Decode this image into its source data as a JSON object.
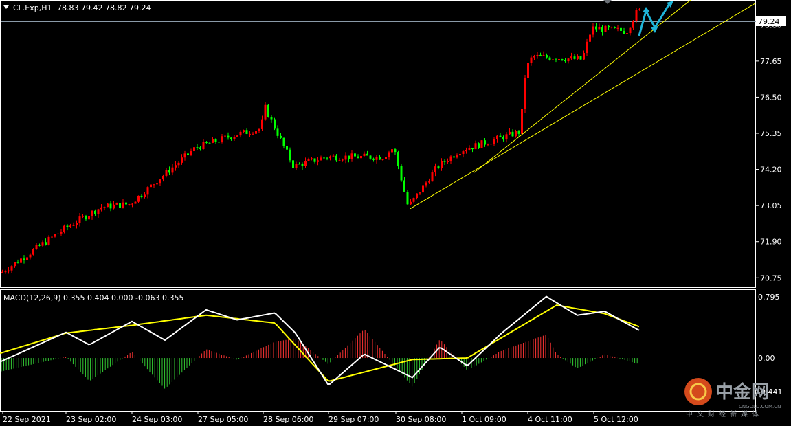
{
  "header": {
    "symbol": "CL.Exp,H1",
    "ohlc": "78.83 79.42 78.82 79.24"
  },
  "price_axis": {
    "current_price": "79.24",
    "ticks": [
      "78.80",
      "77.65",
      "76.50",
      "75.35",
      "74.20",
      "73.05",
      "71.90",
      "70.75"
    ]
  },
  "macd": {
    "label": "MACD(12,26,9) 0.355 0.404 0.000 -0.063 0.355",
    "ticks": [
      "0.795",
      "0.00",
      "-0.441"
    ]
  },
  "time_axis": {
    "ticks": [
      "22 Sep 2021",
      "23 Sep 02:00",
      "24 Sep 03:00",
      "27 Sep 05:00",
      "28 Sep 06:00",
      "29 Sep 07:00",
      "30 Sep 08:00",
      "1 Oct 09:00",
      "4 Oct 11:00",
      "5 Oct 12:00"
    ]
  },
  "watermark": {
    "brand": "中金网",
    "domain": "CNGOLD.COM.CN",
    "tagline": "中文财经新媒体"
  },
  "colors": {
    "background": "#000000",
    "bull": "#ff0000",
    "bear": "#00ff00",
    "grid_text": "#ffffff",
    "trendline": "#ffff00",
    "arrow": "#1fb5d8",
    "macd_line": "#ffffff",
    "signal_line": "#ffff00",
    "hist_pos": "#ff3333",
    "hist_neg": "#33cc33"
  },
  "chart_data": [
    {
      "type": "candlestick",
      "symbol": "CL.Exp",
      "timeframe": "H1",
      "ylim": [
        70.45,
        79.55
      ],
      "current_price": 79.24,
      "anchors": [
        {
          "x": "22 Sep 2021",
          "price": 70.9
        },
        {
          "x": "23 Sep 02:00",
          "price": 72.3
        },
        {
          "x": "23 Sep mid",
          "price": 73.0
        },
        {
          "x": "24 Sep 03:00",
          "price": 73.1
        },
        {
          "x": "24 Sep end",
          "price": 74.0
        },
        {
          "x": "27 Sep 05:00",
          "price": 74.9
        },
        {
          "x": "27 Sep end",
          "price": 75.3
        },
        {
          "x": "28 Sep peak",
          "price": 76.2
        },
        {
          "x": "28 Sep 06:00",
          "price": 75.5
        },
        {
          "x": "28 Sep late",
          "price": 74.3
        },
        {
          "x": "29 Sep 07:00",
          "price": 74.6
        },
        {
          "x": "29 Sep late",
          "price": 74.6
        },
        {
          "x": "30 Sep low",
          "price": 73.0
        },
        {
          "x": "30 Sep 08:00",
          "price": 74.9
        },
        {
          "x": "30 Sep late",
          "price": 74.3
        },
        {
          "x": "1 Oct 09:00",
          "price": 74.8
        },
        {
          "x": "1 Oct late",
          "price": 75.4
        },
        {
          "x": "4 Oct jump",
          "price": 77.8
        },
        {
          "x": "4 Oct 11:00",
          "price": 77.4
        },
        {
          "x": "4 Oct late",
          "price": 77.7
        },
        {
          "x": "5 Oct 12:00",
          "price": 78.7
        },
        {
          "x": "5 Oct late",
          "price": 78.6
        },
        {
          "x": "last",
          "price": 79.24
        }
      ],
      "trendlines": [
        {
          "from": {
            "x": "30 Sep 08:00",
            "price": 72.95
          },
          "to": {
            "x": "extends right",
            "price": 79.3
          }
        },
        {
          "from": {
            "x": "1 Oct 09:00",
            "price": 74.1
          },
          "to": {
            "x": "extends right",
            "price": 79.5
          }
        }
      ]
    },
    {
      "type": "macd",
      "params": [
        12,
        26,
        9
      ],
      "ylim": [
        -0.441,
        0.795
      ],
      "values": {
        "macd": 0.355,
        "signal": 0.404,
        "histogram_a": 0.0,
        "histogram_b": -0.063,
        "last": 0.355
      },
      "macd_anchors": [
        {
          "x": "22 Sep 2021",
          "y": -0.05
        },
        {
          "x": "23 Sep 02:00",
          "y": 0.33
        },
        {
          "x": "23 Sep mid",
          "y": 0.17
        },
        {
          "x": "24 Sep 03:00",
          "y": 0.47
        },
        {
          "x": "24 Sep end",
          "y": 0.23
        },
        {
          "x": "27 Sep 05:00",
          "y": 0.62
        },
        {
          "x": "27 Sep end",
          "y": 0.49
        },
        {
          "x": "28 Sep 06:00",
          "y": 0.58
        },
        {
          "x": "28 Sep late",
          "y": 0.32
        },
        {
          "x": "29 Sep 07:00",
          "y": -0.35
        },
        {
          "x": "29 Sep late",
          "y": 0.05
        },
        {
          "x": "30 Sep 08:00",
          "y": -0.25
        },
        {
          "x": "30 Sep late",
          "y": 0.14
        },
        {
          "x": "1 Oct 09:00",
          "y": -0.1
        },
        {
          "x": "1 Oct late",
          "y": 0.32
        },
        {
          "x": "4 Oct 11:00",
          "y": 0.79
        },
        {
          "x": "4 Oct late",
          "y": 0.55
        },
        {
          "x": "5 Oct 12:00",
          "y": 0.6
        },
        {
          "x": "last",
          "y": 0.355
        }
      ],
      "signal_anchors": [
        {
          "x": "22 Sep 2021",
          "y": 0.06
        },
        {
          "x": "23 Sep 02:00",
          "y": 0.32
        },
        {
          "x": "24 Sep 03:00",
          "y": 0.42
        },
        {
          "x": "27 Sep 05:00",
          "y": 0.55
        },
        {
          "x": "28 Sep 06:00",
          "y": 0.45
        },
        {
          "x": "29 Sep 07:00",
          "y": -0.3
        },
        {
          "x": "30 Sep 08:00",
          "y": -0.02
        },
        {
          "x": "1 Oct 09:00",
          "y": 0.0
        },
        {
          "x": "4 Oct 11:00",
          "y": 0.68
        },
        {
          "x": "5 Oct 12:00",
          "y": 0.57
        },
        {
          "x": "last",
          "y": 0.404
        }
      ]
    }
  ]
}
